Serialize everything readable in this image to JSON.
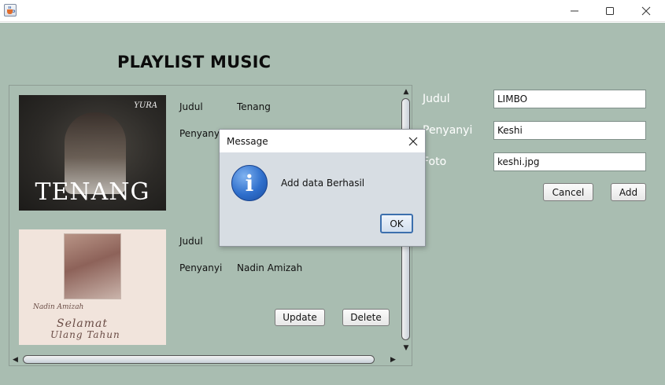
{
  "window": {
    "title": "",
    "icons": {
      "app": "java-cup-icon",
      "minimize": "minimize-icon",
      "maximize": "maximize-icon",
      "close": "close-icon"
    }
  },
  "page": {
    "heading": "PLAYLIST MUSIC",
    "background": "#a9bdb1"
  },
  "playlist": {
    "items": [
      {
        "cover": {
          "brand": "YURA",
          "word": "TENANG"
        },
        "judul_label": "Judul",
        "judul_value": "Tenang",
        "penyanyi_label": "Penyanyi",
        "penyanyi_value": ""
      },
      {
        "cover": {
          "script_top": "Nadin Amizah",
          "script_mid": "Selamat",
          "script_bottom": "Ulang Tahun"
        },
        "judul_label": "Judul",
        "judul_value": "",
        "penyanyi_label": "Penyanyi",
        "penyanyi_value": "Nadin Amizah",
        "update_label": "Update",
        "delete_label": "Delete"
      }
    ],
    "scroll_up": "▲",
    "scroll_down": "▼",
    "scroll_left": "◀",
    "scroll_right": "▶"
  },
  "form": {
    "judul_label": "Judul",
    "judul_value": "LIMBO",
    "penyanyi_label": "Penyanyi",
    "penyanyi_value": "Keshi",
    "foto_label": "Foto",
    "foto_value": "keshi.jpg",
    "cancel_label": "Cancel",
    "add_label": "Add"
  },
  "dialog": {
    "title": "Message",
    "message": "Add data Berhasil",
    "icon_glyph": "i",
    "ok_label": "OK",
    "icon": "info-icon"
  }
}
